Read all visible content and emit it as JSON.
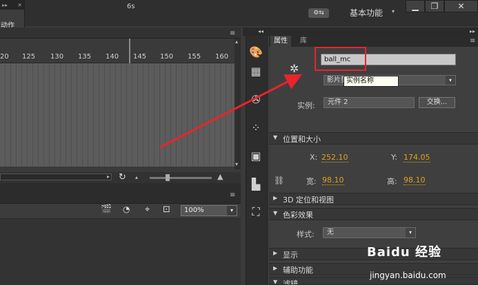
{
  "top_bar": {
    "mini_panel_label": "动作",
    "mini_panel_arrows": "▸▸",
    "mini_panel_close": "✕",
    "sync_icon": "sync-settings-icon",
    "workspace_label": "基本功能",
    "workspace_caret": "▾",
    "minimize": "▁",
    "restore": "❐",
    "close": "✕"
  },
  "timeline": {
    "playhead_label": "6s",
    "ticks": [
      "20",
      "125",
      "130",
      "135",
      "140",
      "145",
      "150",
      "155",
      "160"
    ],
    "menu_icon": "≡",
    "scroll_up": "▴",
    "scroll_down": "▾",
    "hscroll_right": "▸",
    "loop_icon": "↻",
    "small_triangle": "▴",
    "large_triangle": "▲"
  },
  "stage": {
    "zoom_value": "100%",
    "zoom_arrow": "▾",
    "menu_icon": "≡"
  },
  "panel": {
    "collapse": "◂◂",
    "expand": "▸▸",
    "tab_properties": "属性",
    "tab_library": "库",
    "menu_icon": "≡",
    "instance_name_value": "ball_mc",
    "symbol_type_value": "影片剪辑",
    "symbol_type_arrow": "▾",
    "tooltip": "实例名称",
    "instance_of_label": "实例:",
    "instance_of_value": "元件 2",
    "swap_button": "交换..."
  },
  "sections": {
    "position_size": "位置和大小",
    "three_d": "3D 定位和视图",
    "color_effect": "色彩效果",
    "display": "显示",
    "accessibility": "辅助功能",
    "filters": "滤镜"
  },
  "position": {
    "x_label": "X:",
    "x_value": "252.10",
    "y_label": "Y:",
    "y_value": "174.05",
    "w_label": "宽:",
    "w_value": "98.10",
    "h_label": "高:",
    "h_value": "98.10"
  },
  "color": {
    "style_label": "样式:",
    "style_value": "无",
    "style_arrow": "▾"
  },
  "watermark": {
    "logo": "Baidu 经验",
    "url": "jingyan.baidu.com"
  },
  "colors": {
    "annotation_red": "#e8242c",
    "value_orange": "#e0a020"
  }
}
